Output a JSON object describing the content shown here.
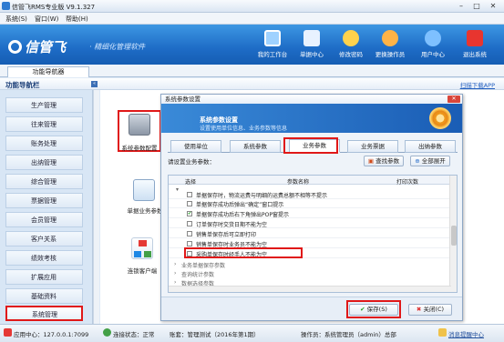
{
  "window": {
    "title": "信管飞RMS专业版 V9.1.327"
  },
  "menu": [
    "系统(S)",
    "窗口(W)",
    "帮助(H)"
  ],
  "banner": {
    "logo": "信管飞",
    "slogan": "· 精细化管理软件",
    "toolbar": [
      {
        "label": "我的工作台",
        "icon": "monitor-icon",
        "color": "#9fd2ff"
      },
      {
        "label": "单据中心",
        "icon": "list-icon",
        "color": "#e8f2ff"
      },
      {
        "label": "修改密码",
        "icon": "key-user-icon",
        "color": "#ffd24d"
      },
      {
        "label": "更换操作员",
        "icon": "user-icon",
        "color": "#ffb347"
      },
      {
        "label": "用户中心",
        "icon": "person-icon",
        "color": "#7ec0ff"
      },
      {
        "label": "退出系统",
        "icon": "power-icon",
        "color": "#e8352f"
      }
    ]
  },
  "tabs": {
    "nav": "功能导航器"
  },
  "section": {
    "title": "功能导航栏",
    "link": "扫描下载APP"
  },
  "sidebar": {
    "items": [
      "生产管理",
      "往来管理",
      "账务处理",
      "出纳管理",
      "综合管理",
      "票据管理",
      "会员管理",
      "客户关系",
      "绩效考核",
      "扩展应用",
      "基础资料",
      "系统管理"
    ],
    "selected": "系统管理"
  },
  "modules": [
    {
      "label": "系统参数配置"
    },
    {
      "label": "单据业务参数"
    },
    {
      "label": "连锁客户端"
    }
  ],
  "dialog": {
    "title": "系统参数设置",
    "heading": "系统参数设置",
    "subheading": "设置使用单位信息、业务参数等信息",
    "tabs": [
      "使用单位",
      "系统参数",
      "业务参数",
      "业务票据",
      "出纳参数"
    ],
    "active_tab": "业务参数",
    "select_label": "请设置业务参数：",
    "find_button": "查找参数",
    "expand_button": "全部展开",
    "columns": [
      "选择",
      "参数名称",
      "打印次数"
    ],
    "rows": [
      {
        "checked": false,
        "label": "单据保存时，物流运费与明细的运费总额不相等不提示"
      },
      {
        "checked": false,
        "label": "单据保存成功后弹出“确定”窗口提示"
      },
      {
        "checked": true,
        "label": "单据保存成功后右下角弹出POP窗提示"
      },
      {
        "checked": false,
        "label": "订单保存时交货日期不能为空"
      },
      {
        "checked": false,
        "label": "销售单保存后可立即打印"
      },
      {
        "checked": false,
        "label": "销售单保存时业务员不能为空"
      },
      {
        "checked": false,
        "label": "采购单保存时经手人不能为空"
      }
    ],
    "groups": [
      "业务单据保存参数",
      "查询统计参数",
      "数据选择参数"
    ],
    "save_button": "保存(S)",
    "close_button": "关闭(C)"
  },
  "statusbar": {
    "server": "应用中心：127.0.0.1:7099",
    "conn": "连接状态：正常",
    "account": "账套：管理测试（2016年第1期）",
    "operator": "操作员：系统管理员（admin）总部",
    "msg": "消息提醒中心"
  }
}
